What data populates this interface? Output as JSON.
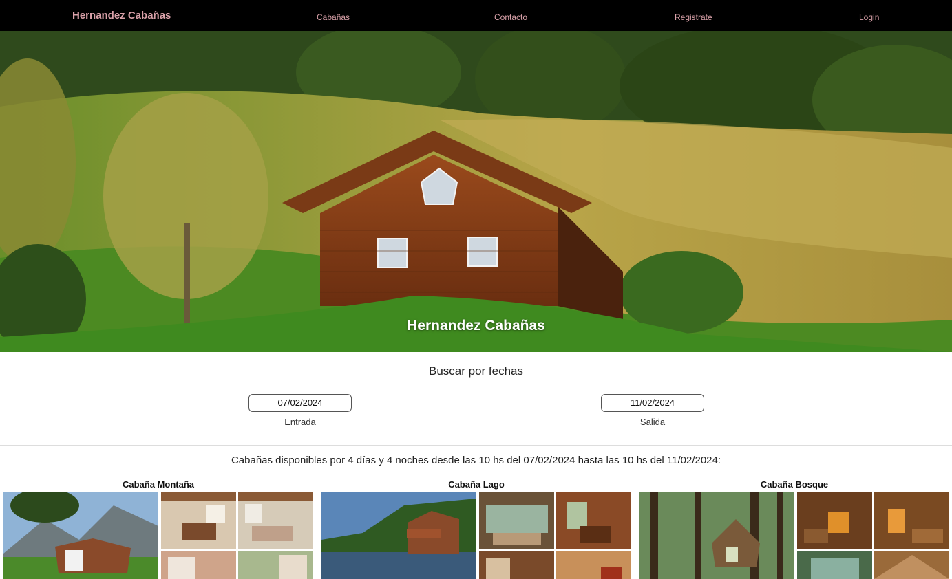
{
  "nav": {
    "brand": "Hernandez Cabañas",
    "links": [
      "Cabañas",
      "Contacto",
      "Registrate",
      "Login"
    ]
  },
  "hero": {
    "title": "Hernandez Cabañas"
  },
  "search": {
    "title": "Buscar por fechas",
    "entry_value": "07/02/2024",
    "entry_label": "Entrada",
    "exit_value": "11/02/2024",
    "exit_label": "Salida"
  },
  "availability_text": "Cabañas disponibles por 4 días y 4 noches desde las 10 hs del 07/02/2024 hasta las 10 hs del 11/02/2024:",
  "cabins": [
    {
      "name": "Cabaña Montaña"
    },
    {
      "name": "Cabaña Lago"
    },
    {
      "name": "Cabaña Bosque"
    }
  ],
  "colors": {
    "nav_bg": "#000000",
    "nav_text": "#d9a1a9"
  }
}
